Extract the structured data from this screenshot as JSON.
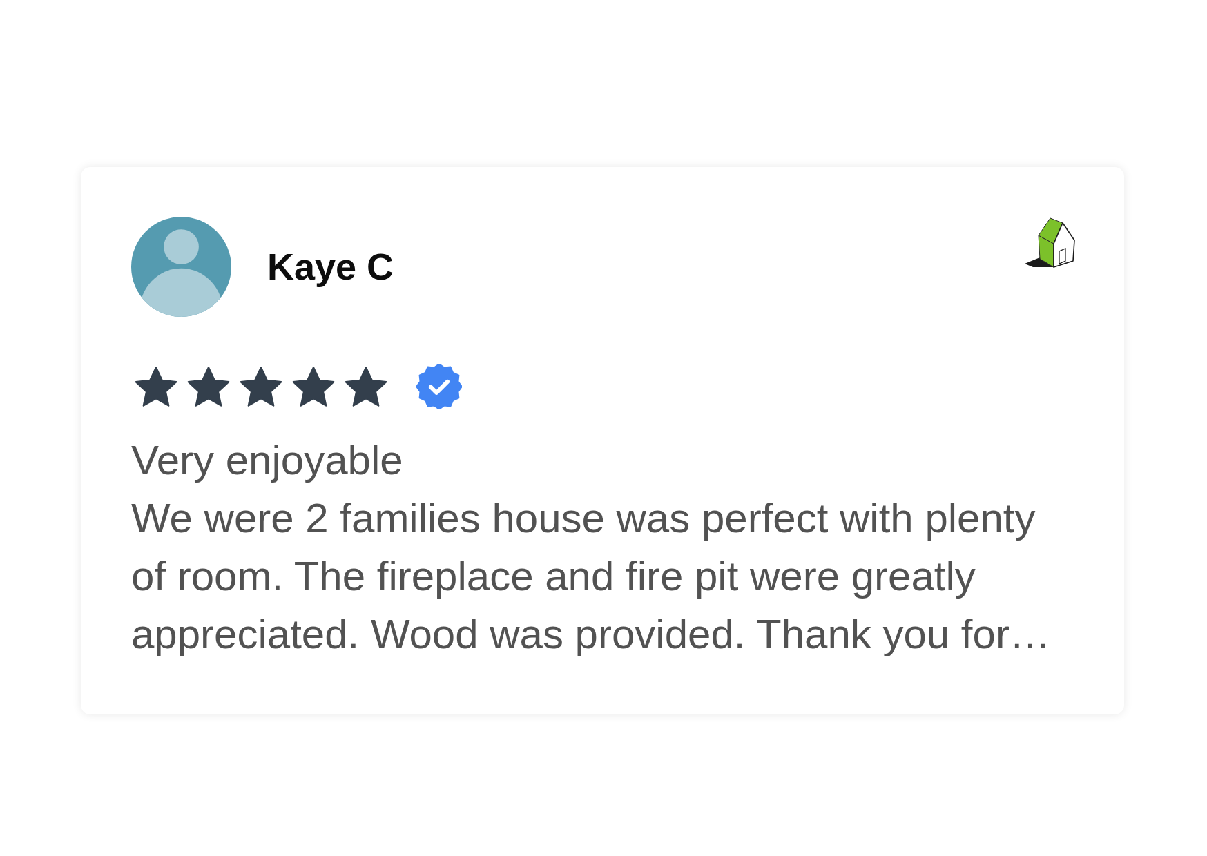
{
  "review": {
    "reviewer": {
      "name": "Kaye C"
    },
    "stars": 5,
    "verified": true,
    "title": "Very enjoyable",
    "text": "We were 2 families house was perfect with plenty of room. The fireplace and fire pit were greatly appreciated. Wood was provided. Thank you for…"
  }
}
